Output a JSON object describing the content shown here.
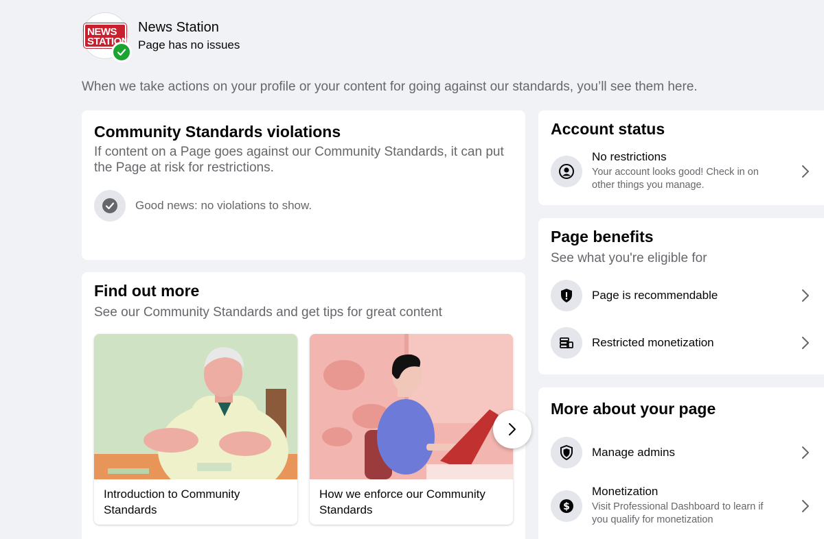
{
  "page": {
    "name": "News Station",
    "status": "Page has no issues",
    "logo_line1": "NEWS",
    "logo_line2": "STATION"
  },
  "intro": "When we take actions on your profile or your content for going against our standards, you’ll see them here.",
  "violations": {
    "title": "Community Standards violations",
    "subtitle": "If content on a Page goes against our Community Standards, it can put the Page at risk for restrictions.",
    "good_news": "Good news: no violations to show."
  },
  "find_out_more": {
    "title": "Find out more",
    "subtitle": "See our Community Standards and get tips for great content",
    "cards": [
      {
        "caption": "Introduction to Community Standards"
      },
      {
        "caption": "How we enforce our Community Standards"
      }
    ]
  },
  "account_status": {
    "title": "Account status",
    "item_title": "No restrictions",
    "item_desc": "Your account looks good! Check in on other things you manage."
  },
  "page_benefits": {
    "title": "Page benefits",
    "subtitle": "See what you're eligible for",
    "items": [
      {
        "label": "Page is recommendable",
        "icon": "shield-alert-icon"
      },
      {
        "label": "Restricted monetization",
        "icon": "coins-icon"
      }
    ]
  },
  "more_about": {
    "title": "More about your page",
    "items": [
      {
        "label": "Manage admins",
        "icon": "shield-icon"
      },
      {
        "label": "Monetization",
        "desc": "Visit Professional Dashboard to learn if you qualify for monetization",
        "icon": "dollar-icon"
      }
    ]
  },
  "colors": {
    "accent_green": "#1aa531",
    "brand_red": "#c8202f",
    "secondary_text": "#65676b"
  }
}
